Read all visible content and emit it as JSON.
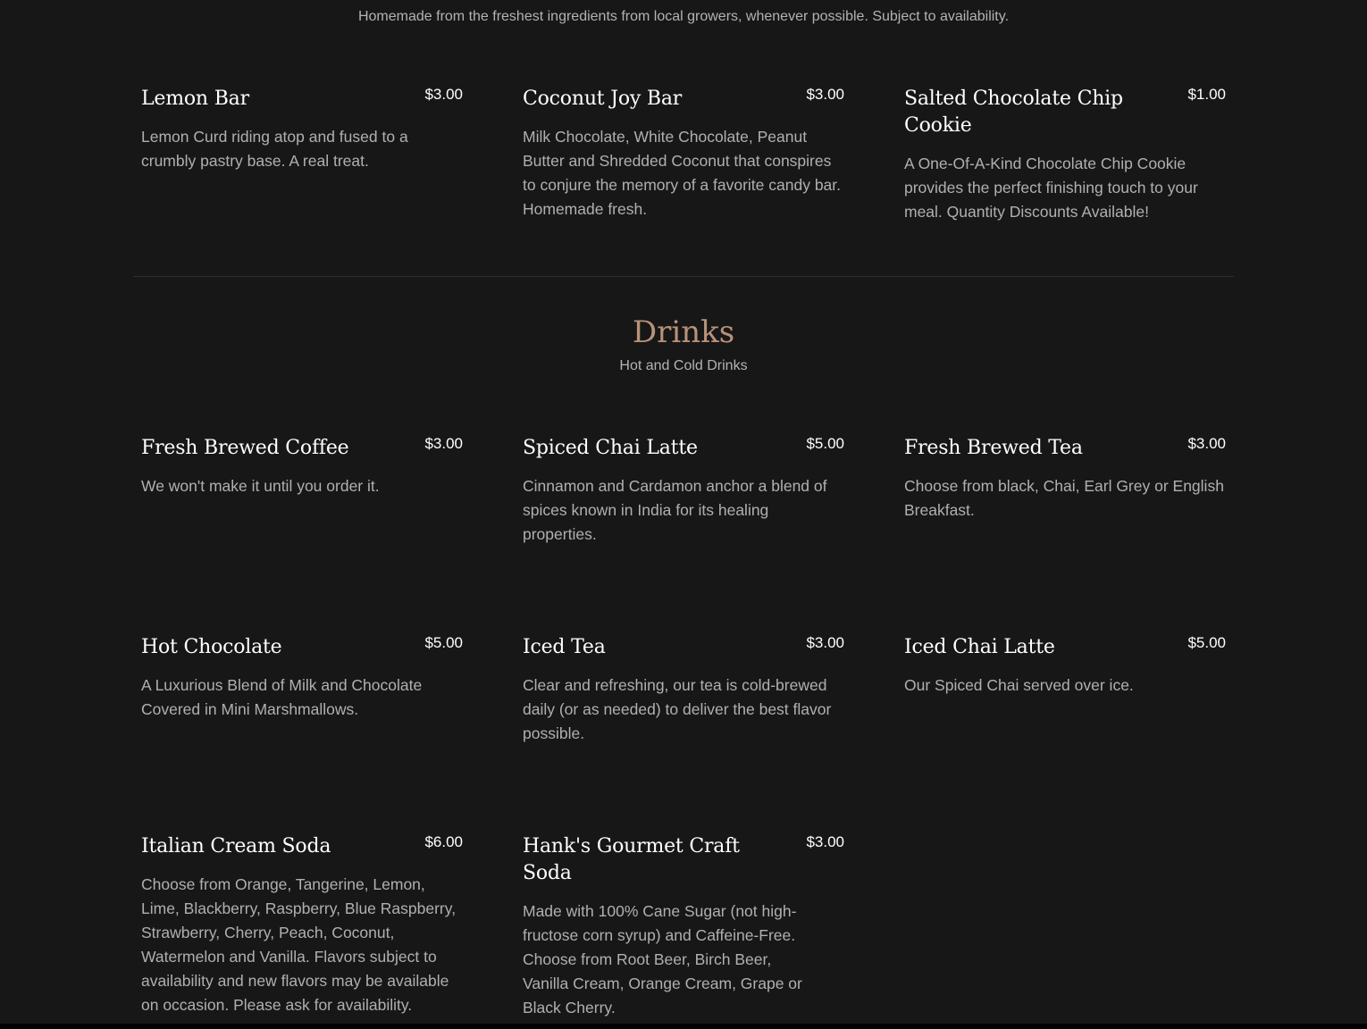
{
  "desserts": {
    "subtitle": "Homemade from the freshest ingredients from local growers, whenever possible. Subject to availability.",
    "items": [
      {
        "name": "Lemon Bar",
        "price": "$3.00",
        "description": "Lemon Curd riding atop and fused to a crumbly pastry base. A real treat."
      },
      {
        "name": "Coconut Joy Bar",
        "price": "$3.00",
        "description": "Milk Chocolate, White Chocolate, Peanut Butter and Shredded Coconut that conspires to conjure the memory of a favorite candy bar. Homemade fresh."
      },
      {
        "name": "Salted Chocolate Chip Cookie",
        "price": "$1.00",
        "description": "A One-Of-A-Kind Chocolate Chip Cookie provides the perfect finishing touch to your meal. Quantity Discounts Available!"
      }
    ]
  },
  "drinks": {
    "title": "Drinks",
    "subtitle": "Hot and Cold Drinks",
    "items": [
      {
        "name": "Fresh Brewed Coffee",
        "price": "$3.00",
        "description": "We won't make it until you order it."
      },
      {
        "name": "Spiced Chai Latte",
        "price": "$5.00",
        "description": "Cinnamon and Cardamon anchor a blend of spices known in India for its healing properties."
      },
      {
        "name": "Fresh Brewed Tea",
        "price": "$3.00",
        "description": "Choose from black, Chai, Earl Grey or English Breakfast."
      },
      {
        "name": "Hot Chocolate",
        "price": "$5.00",
        "description": "A Luxurious Blend of Milk and Chocolate Covered in Mini Marshmallows."
      },
      {
        "name": "Iced Tea",
        "price": "$3.00",
        "description": "Clear and refreshing, our tea is cold-brewed daily (or as needed) to deliver the best flavor possible."
      },
      {
        "name": "Iced Chai Latte",
        "price": "$5.00",
        "description": "Our Spiced Chai served over ice."
      },
      {
        "name": "Italian Cream Soda",
        "price": "$6.00",
        "description": "Choose from Orange, Tangerine, Lemon, Lime, Blackberry, Raspberry, Blue Raspberry, Strawberry, Cherry, Peach, Coconut, Watermelon and Vanilla. Flavors subject to availability and new flavors may be available on occasion. Please ask for availability."
      },
      {
        "name": "Hank's Gourmet Craft Soda",
        "price": "$3.00",
        "description": "Made with 100% Cane Sugar (not high-fructose corn syrup) and  Caffeine-Free. Choose from Root Beer, Birch Beer, Vanilla Cream, Orange Cream, Grape or Black Cherry."
      }
    ]
  },
  "colors": {
    "background": "#171717",
    "accent": "#b8927a",
    "text": "#ffffff",
    "muted": "#b0b0b0"
  }
}
